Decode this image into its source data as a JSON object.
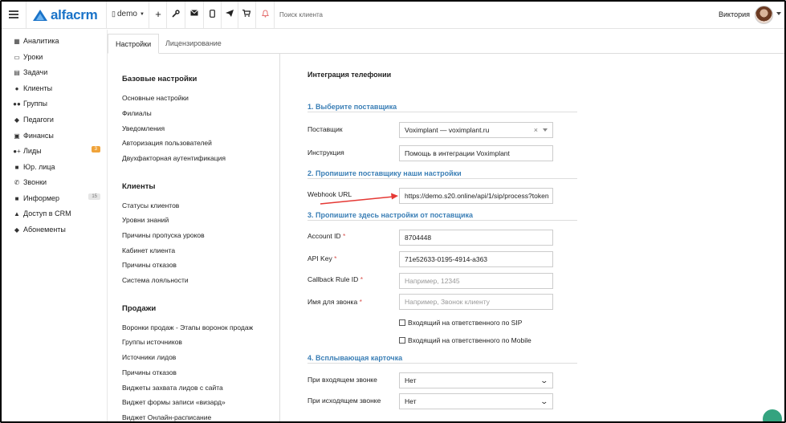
{
  "brand": {
    "name": "alfacrm",
    "accent": "#1a73c8"
  },
  "topbar": {
    "branch": "demo",
    "search_placeholder": "Поиск клиента",
    "user_name": "Виктория"
  },
  "sidebar": {
    "items": [
      {
        "label": "Аналитика",
        "icon": "chart-icon"
      },
      {
        "label": "Уроки",
        "icon": "calendar-icon"
      },
      {
        "label": "Задачи",
        "icon": "tasks-icon"
      },
      {
        "label": "Клиенты",
        "icon": "user-icon"
      },
      {
        "label": "Группы",
        "icon": "group-icon"
      },
      {
        "label": "Педагоги",
        "icon": "graduation-icon"
      },
      {
        "label": "Финансы",
        "icon": "money-icon"
      },
      {
        "label": "Лиды",
        "icon": "lead-icon",
        "badge": "3"
      },
      {
        "label": "Юр. лица",
        "icon": "briefcase-icon"
      },
      {
        "label": "Звонки",
        "icon": "phone-icon"
      },
      {
        "label": "Информер",
        "icon": "list-icon",
        "badge": "15"
      },
      {
        "label": "Доступ в CRM",
        "icon": "lock-icon"
      },
      {
        "label": "Абонементы",
        "icon": "tag-icon"
      }
    ]
  },
  "tabs": [
    {
      "label": "Настройки",
      "active": true
    },
    {
      "label": "Лицензирование",
      "active": false
    }
  ],
  "settings_nav": {
    "sections": [
      {
        "title": "Базовые настройки",
        "links": [
          "Основные настройки",
          "Филиалы",
          "Уведомления",
          "Авторизация пользователей",
          "Двухфакторная аутентификация"
        ]
      },
      {
        "title": "Клиенты",
        "links": [
          "Статусы клиентов",
          "Уровни знаний",
          "Причины пропуска уроков",
          "Кабинет клиента",
          "Причины отказов",
          "Система лояльности"
        ]
      },
      {
        "title": "Продажи",
        "links": [
          "Воронки продаж - Этапы воронок продаж",
          "Группы источников",
          "Источники лидов",
          "Причины отказов",
          "Виджеты захвата лидов с сайта",
          "Виджет формы записи «визард»",
          "Виджет Онлайн-расписание"
        ]
      }
    ]
  },
  "telephony": {
    "title": "Интеграция телефонии",
    "step1": "1. Выберите поставщика",
    "provider_label": "Поставщик",
    "provider_value": "Voximplant — voximplant.ru",
    "instruction_label": "Инструкция",
    "instruction_value": "Помощь в интеграции Voximplant",
    "step2": "2. Пропишите поставщику наши настройки",
    "webhook_label": "Webhook URL",
    "webhook_value": "https://demo.s20.online/api/1/sip/process?token",
    "step3": "3. Пропишите здесь настройки от поставщика",
    "account_label": "Account ID",
    "account_value": "8704448",
    "apikey_label": "API Key",
    "apikey_value": "71e52633-0195-4914-a363",
    "callback_label": "Callback Rule ID",
    "callback_placeholder": "Например, 12345",
    "callname_label": "Имя для звонка",
    "callname_placeholder": "Например, Звонок клиенту",
    "checkbox_incoming_sip": "Входящий на ответственного по SIP",
    "checkbox_incoming_mobile": "Входящий на ответственного по Mobile",
    "step4": "4. Всплывающая карточка",
    "incoming_label": "При входящем звонке",
    "incoming_value": "Нет",
    "outgoing_label": "При исходящем звонке",
    "outgoing_value": "Нет",
    "required_mark": "*"
  },
  "colors": {
    "step": "#3b7fb6",
    "arrow": "#e53935",
    "badge_orange": "#f0a33a"
  }
}
